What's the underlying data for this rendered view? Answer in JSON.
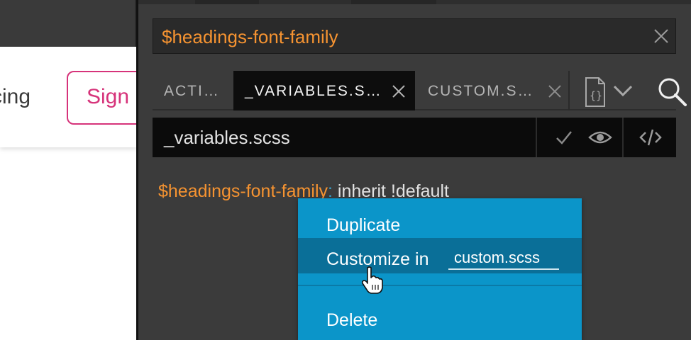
{
  "page": {
    "nav_pricing_fragment": "cing",
    "signup_label": "Sign u"
  },
  "search": {
    "value": "$headings-font-family"
  },
  "tabs": [
    {
      "label": "ACTI…",
      "active": false
    },
    {
      "label": "_VARIABLES.S…",
      "active": true
    },
    {
      "label": "CUSTOM.S…",
      "active": false
    }
  ],
  "file": {
    "name": "_variables.scss"
  },
  "code": {
    "variable": "$headings-font-family",
    "colon": ":",
    "value": " inherit !default"
  },
  "context_menu": {
    "items": [
      {
        "label": "Duplicate"
      },
      {
        "label": "Customize in",
        "target_value": "custom.scss"
      },
      {
        "label": "Delete"
      }
    ]
  },
  "colors": {
    "accent_orange": "#f59331",
    "menu_blue": "#0b95c9",
    "menu_hover": "#0a6f98",
    "signup_pink": "#d6337a"
  },
  "icons": {
    "search_clear": "close-icon",
    "tab_close": "close-icon",
    "file_tool": "file-braces-icon",
    "file_tool_dropdown": "chevron-down-icon",
    "search": "magnifier-icon",
    "check": "check-icon",
    "preview": "eye-icon",
    "code": "code-icon",
    "cursor": "hand-pointer-icon"
  }
}
